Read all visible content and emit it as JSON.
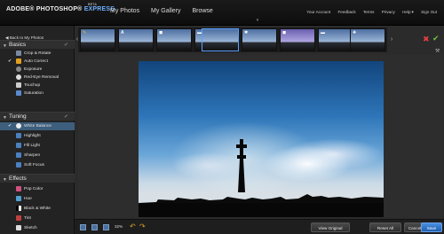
{
  "app": {
    "logo_text": "ADOBE® PHOTOSHOP® ",
    "logo_express": "EXPRESS",
    "beta": "BETA"
  },
  "nav": {
    "items": [
      "My Photos",
      "My Gallery",
      "Browse"
    ]
  },
  "top_links": [
    "Your Account",
    "Feedback",
    "Terms",
    "Privacy",
    "Help",
    "Sign Out"
  ],
  "sidebar": {
    "back_label": "Back to My Photos",
    "sections": [
      {
        "title": "Basics",
        "items": [
          "Crop & Rotate",
          "Auto Correct",
          "Exposure",
          "Red-Eye Removal",
          "Touchup",
          "Saturation"
        ]
      },
      {
        "title": "Tuning",
        "items": [
          "White Balance",
          "Highlight",
          "Fill Light",
          "Sharpen",
          "Soft Focus"
        ]
      },
      {
        "title": "Effects",
        "items": [
          "Pop Color",
          "Hue",
          "Black & White",
          "Tint",
          "Sketch"
        ]
      }
    ]
  },
  "filmstrip": {
    "thumbs": 8,
    "selected_index": 3
  },
  "bottombar": {
    "zoom": "32%",
    "view_original": "View Original",
    "reset_all": "Reset All",
    "cancel": "Cancel",
    "save": "Save"
  },
  "colors": {
    "accent": "#3d5e7d",
    "save_button": "#2f74c8",
    "cancel_icon": "#e04040",
    "ok_icon": "#6ec040"
  }
}
